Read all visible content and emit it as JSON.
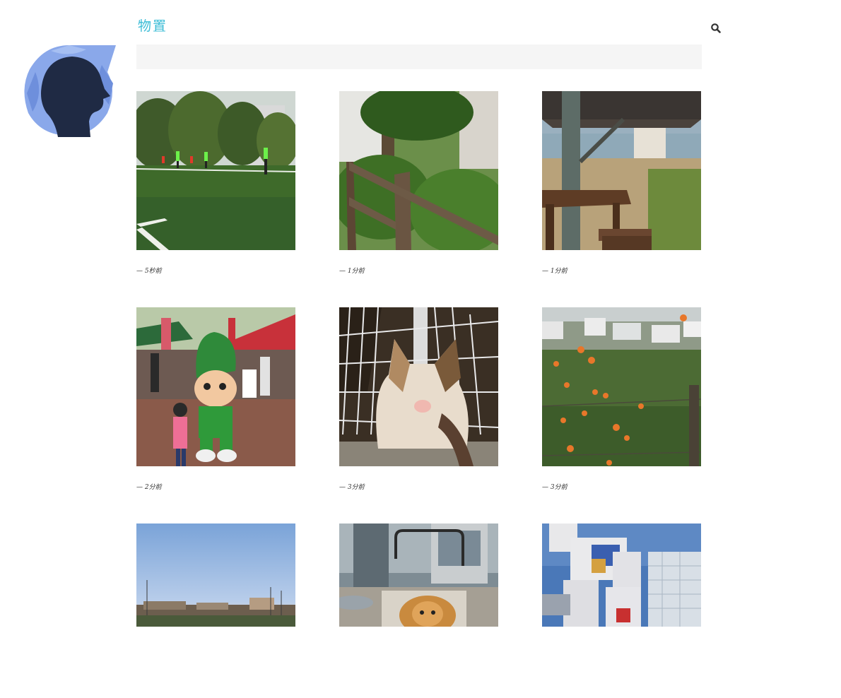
{
  "site": {
    "title": "物置"
  },
  "icons": {
    "avatar": "head-silhouette-avatar-icon",
    "search": "search-icon"
  },
  "colors": {
    "title": "#3bbcd6",
    "banner": "#f5f5f5",
    "avatar_bg": "#7c9be0",
    "avatar_silhouette": "#1f2a44"
  },
  "posts": [
    {
      "time": "— 5秒前",
      "photo": "football-field"
    },
    {
      "time": "— 1分前",
      "photo": "wooden-fence-garden"
    },
    {
      "time": "— 1分前",
      "photo": "pavilion-bench"
    },
    {
      "time": "— 2分前",
      "photo": "green-mascot"
    },
    {
      "time": "— 3分前",
      "photo": "cat-by-fence"
    },
    {
      "time": "— 3分前",
      "photo": "orange-cosmos-field"
    },
    {
      "time": "",
      "photo": "evening-sky-field"
    },
    {
      "time": "",
      "photo": "dog-in-stroller"
    },
    {
      "time": "",
      "photo": "gundam-statue"
    }
  ]
}
